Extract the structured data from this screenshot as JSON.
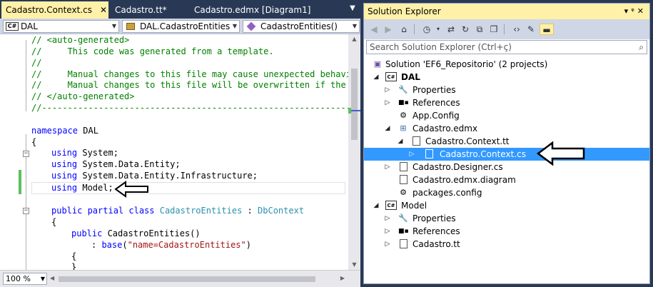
{
  "editor": {
    "tabs": [
      {
        "label": "Cadastro.Context.cs",
        "active": true
      },
      {
        "label": "Cadastro.tt*",
        "active": false
      },
      {
        "label": "Cadastro.edmx [Diagram1]",
        "active": false
      }
    ],
    "nav": {
      "project": "DAL",
      "project_badge": "C#",
      "type": "DAL.CadastroEntities",
      "member": "CadastroEntities()"
    },
    "code_lines": {
      "l1": "// <auto-generated>",
      "l2": "//     This code was generated from a template.",
      "l3": "//",
      "l4": "//     Manual changes to this file may cause unexpected behavio",
      "l5": "//     Manual changes to this file will be overwritten if the c",
      "l6": "// </auto-generated>",
      "l7": "//------------------------------------------------------------",
      "ns_kw": "namespace",
      "ns_name": " DAL",
      "open1": "{",
      "using_kw": "using",
      "u1": " System;",
      "u2": " System.Data.Entity;",
      "u3": " System.Data.Entity.Infrastructure;",
      "u4": " Model;",
      "cls_mods": "public partial class",
      "cls_name": "CadastroEntities",
      "cls_colon": " : ",
      "cls_base": "DbContext",
      "open2": "{",
      "ctor_kw": "public",
      "ctor_name": " CadastroEntities()",
      "base_pre": ": ",
      "base_kw": "base",
      "base_open": "(",
      "base_str": "\"name=CadastroEntities\"",
      "base_close": ")",
      "open3": "{",
      "close3": "}"
    },
    "zoom": "100 %"
  },
  "explorer": {
    "title": "Solution Explorer",
    "search_placeholder": "Search Solution Explorer (Ctrl+ç)",
    "tree": [
      {
        "label": "Solution 'EF6_Repositorio' (2 projects)"
      },
      {
        "label": "DAL",
        "badge": "C#"
      },
      {
        "label": "Properties"
      },
      {
        "label": "References"
      },
      {
        "label": "App.Config"
      },
      {
        "label": "Cadastro.edmx"
      },
      {
        "label": "Cadastro.Context.tt"
      },
      {
        "label": "Cadastro.Context.cs"
      },
      {
        "label": "Cadastro.Designer.cs"
      },
      {
        "label": "Cadastro.edmx.diagram"
      },
      {
        "label": "packages.config"
      },
      {
        "label": "Model",
        "badge": "C#"
      },
      {
        "label": "Properties"
      },
      {
        "label": "References"
      },
      {
        "label": "Cadastro.tt"
      }
    ]
  },
  "colors": {
    "accent_tab": "#fff1a8",
    "selection": "#3399ff",
    "chrome": "#293955"
  }
}
